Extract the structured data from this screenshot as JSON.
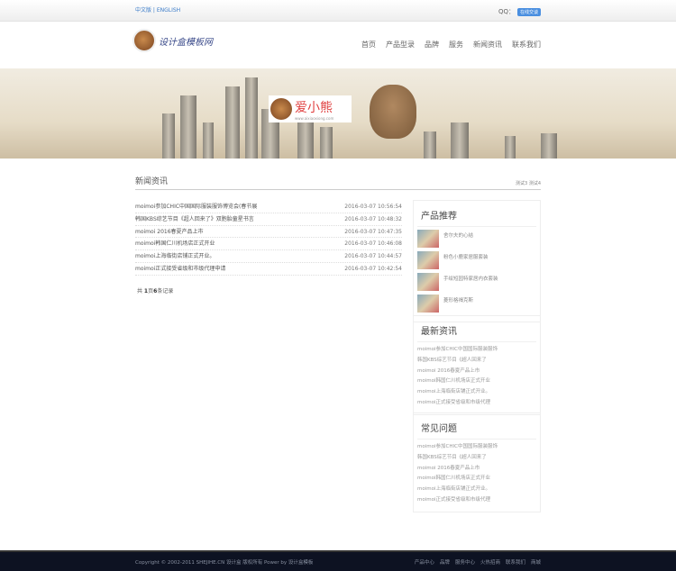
{
  "topbar": {
    "lang": "中文版 | ENGLISH",
    "qq_label": "QQ：",
    "qq_button": "在线交谈"
  },
  "header": {
    "logo_text": "设计盒模板网",
    "nav": [
      "首页",
      "产品型录",
      "品牌",
      "服务",
      "新闻资讯",
      "联系我们"
    ]
  },
  "banner": {
    "brand": "爱小熊",
    "site": "www.aixiaoxiong.com"
  },
  "news": {
    "title": "新闻资讯",
    "links": [
      "测试3",
      "测试4"
    ],
    "rows": [
      {
        "title": "moimoi参加CHIC中国国际服装服饰博览会(春节展",
        "date": "2016-03-07 10:56:54"
      },
      {
        "title": "韩国KBS综艺节目《超人回来了》双胞胎童星书言",
        "date": "2016-03-07 10:48:32"
      },
      {
        "title": "moimoi 2016春夏产品上市",
        "date": "2016-03-07 10:47:35"
      },
      {
        "title": "moimoi韩国仁川机场店正式开业",
        "date": "2016-03-07 10:46:08"
      },
      {
        "title": "moimoi上海临街店铺正式开业。",
        "date": "2016-03-07 10:44:57"
      },
      {
        "title": "moimoi正式接受省级和市级代理申请",
        "date": "2016-03-07 10:42:54"
      }
    ],
    "pager": {
      "prefix": "共 ",
      "pages": "1",
      "mid": "页",
      "count": "6",
      "suffix": "条记录"
    }
  },
  "sidebar": {
    "products": {
      "title": "产品推荐",
      "items": [
        "舍尔夫的心结",
        "粉色小鹿家居服套装",
        "手绘短园特家居内衣套装",
        "菱形格褐克斯"
      ]
    },
    "latest": {
      "title": "最新资讯",
      "items": [
        "moimoi参加CHIC中国国际服装服饰",
        "韩国KBS综艺节目《超人回来了",
        "moimoi 2016春夏产品上市",
        "moimoi韩国仁川机场店正式开业",
        "moimoi上海临街店铺正式开业。",
        "moimoi正式接受省级和市级代理"
      ]
    },
    "faq": {
      "title": "常见问题",
      "items": [
        "moimoi参加CHIC中国国际服装服饰",
        "韩国KBS综艺节目《超人回来了",
        "moimoi 2016春夏产品上市",
        "moimoi韩国仁川机场店正式开业",
        "moimoi上海临街店铺正式开业。",
        "moimoi正式接受省级和市级代理"
      ]
    }
  },
  "footer": {
    "copyright": "Copyright © 2002-2011 SHEJIHE.CN 设计盒 版权所有 Power by 设计盒模板",
    "links": [
      "产品中心",
      "品牌",
      "服务中心",
      "火热招商",
      "联系我们",
      "商城"
    ]
  }
}
